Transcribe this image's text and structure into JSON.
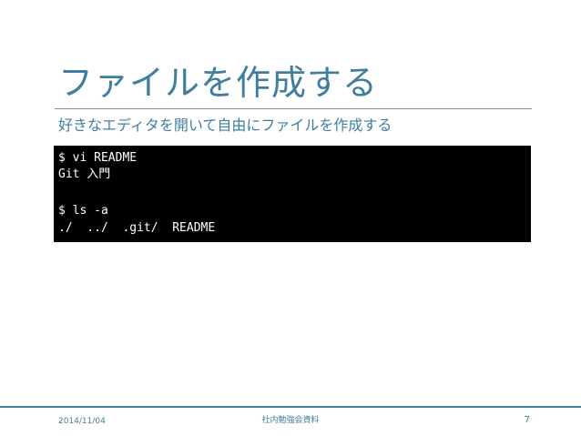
{
  "slide": {
    "title": "ファイルを作成する",
    "subtitle": "好きなエディタを開いて自由にファイルを作成する",
    "terminal_lines": [
      "$ vi README",
      "Git 入門",
      "",
      "$ ls -a",
      "./  ../  .git/  README"
    ],
    "footer": {
      "date": "2014/11/04",
      "center": "社内勉強会資料",
      "page": "7"
    }
  },
  "colors": {
    "accent": "#3f7f9e",
    "terminal_bg": "#000000",
    "terminal_text": "#ffffff"
  }
}
